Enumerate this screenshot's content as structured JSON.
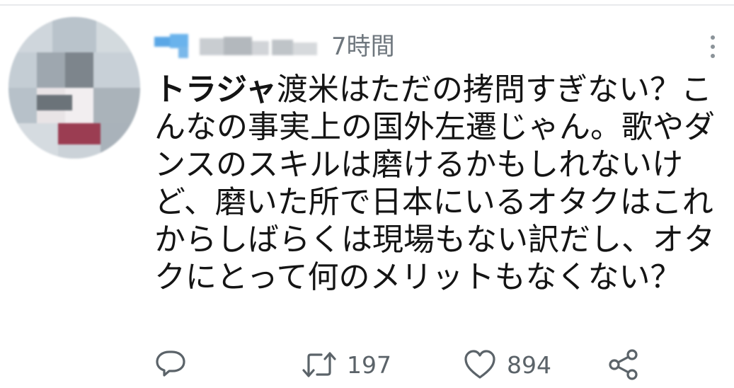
{
  "tweet": {
    "timestamp": "7時間",
    "text_bold": "トラジャ",
    "text_rest": "渡米はただの拷問すぎない？こんなの事実上の国外左遷じゃん。歌やダンスのスキルは磨けるかもしれないけど、磨いた所で日本にいるオタクはこれからしばらくは現場もない訳だし、オタクにとって何のメリットもなくない？"
  },
  "actions": {
    "retweet_count": "197",
    "like_count": "894"
  },
  "icons": {
    "more": "more-vertical-icon",
    "reply": "reply-icon",
    "retweet": "retweet-icon",
    "like": "heart-icon",
    "share": "share-icon"
  },
  "colors": {
    "text": "#141414",
    "muted": "#6e767d",
    "icon": "#5b6369",
    "name_blur_blue": "#5aa7e6"
  }
}
